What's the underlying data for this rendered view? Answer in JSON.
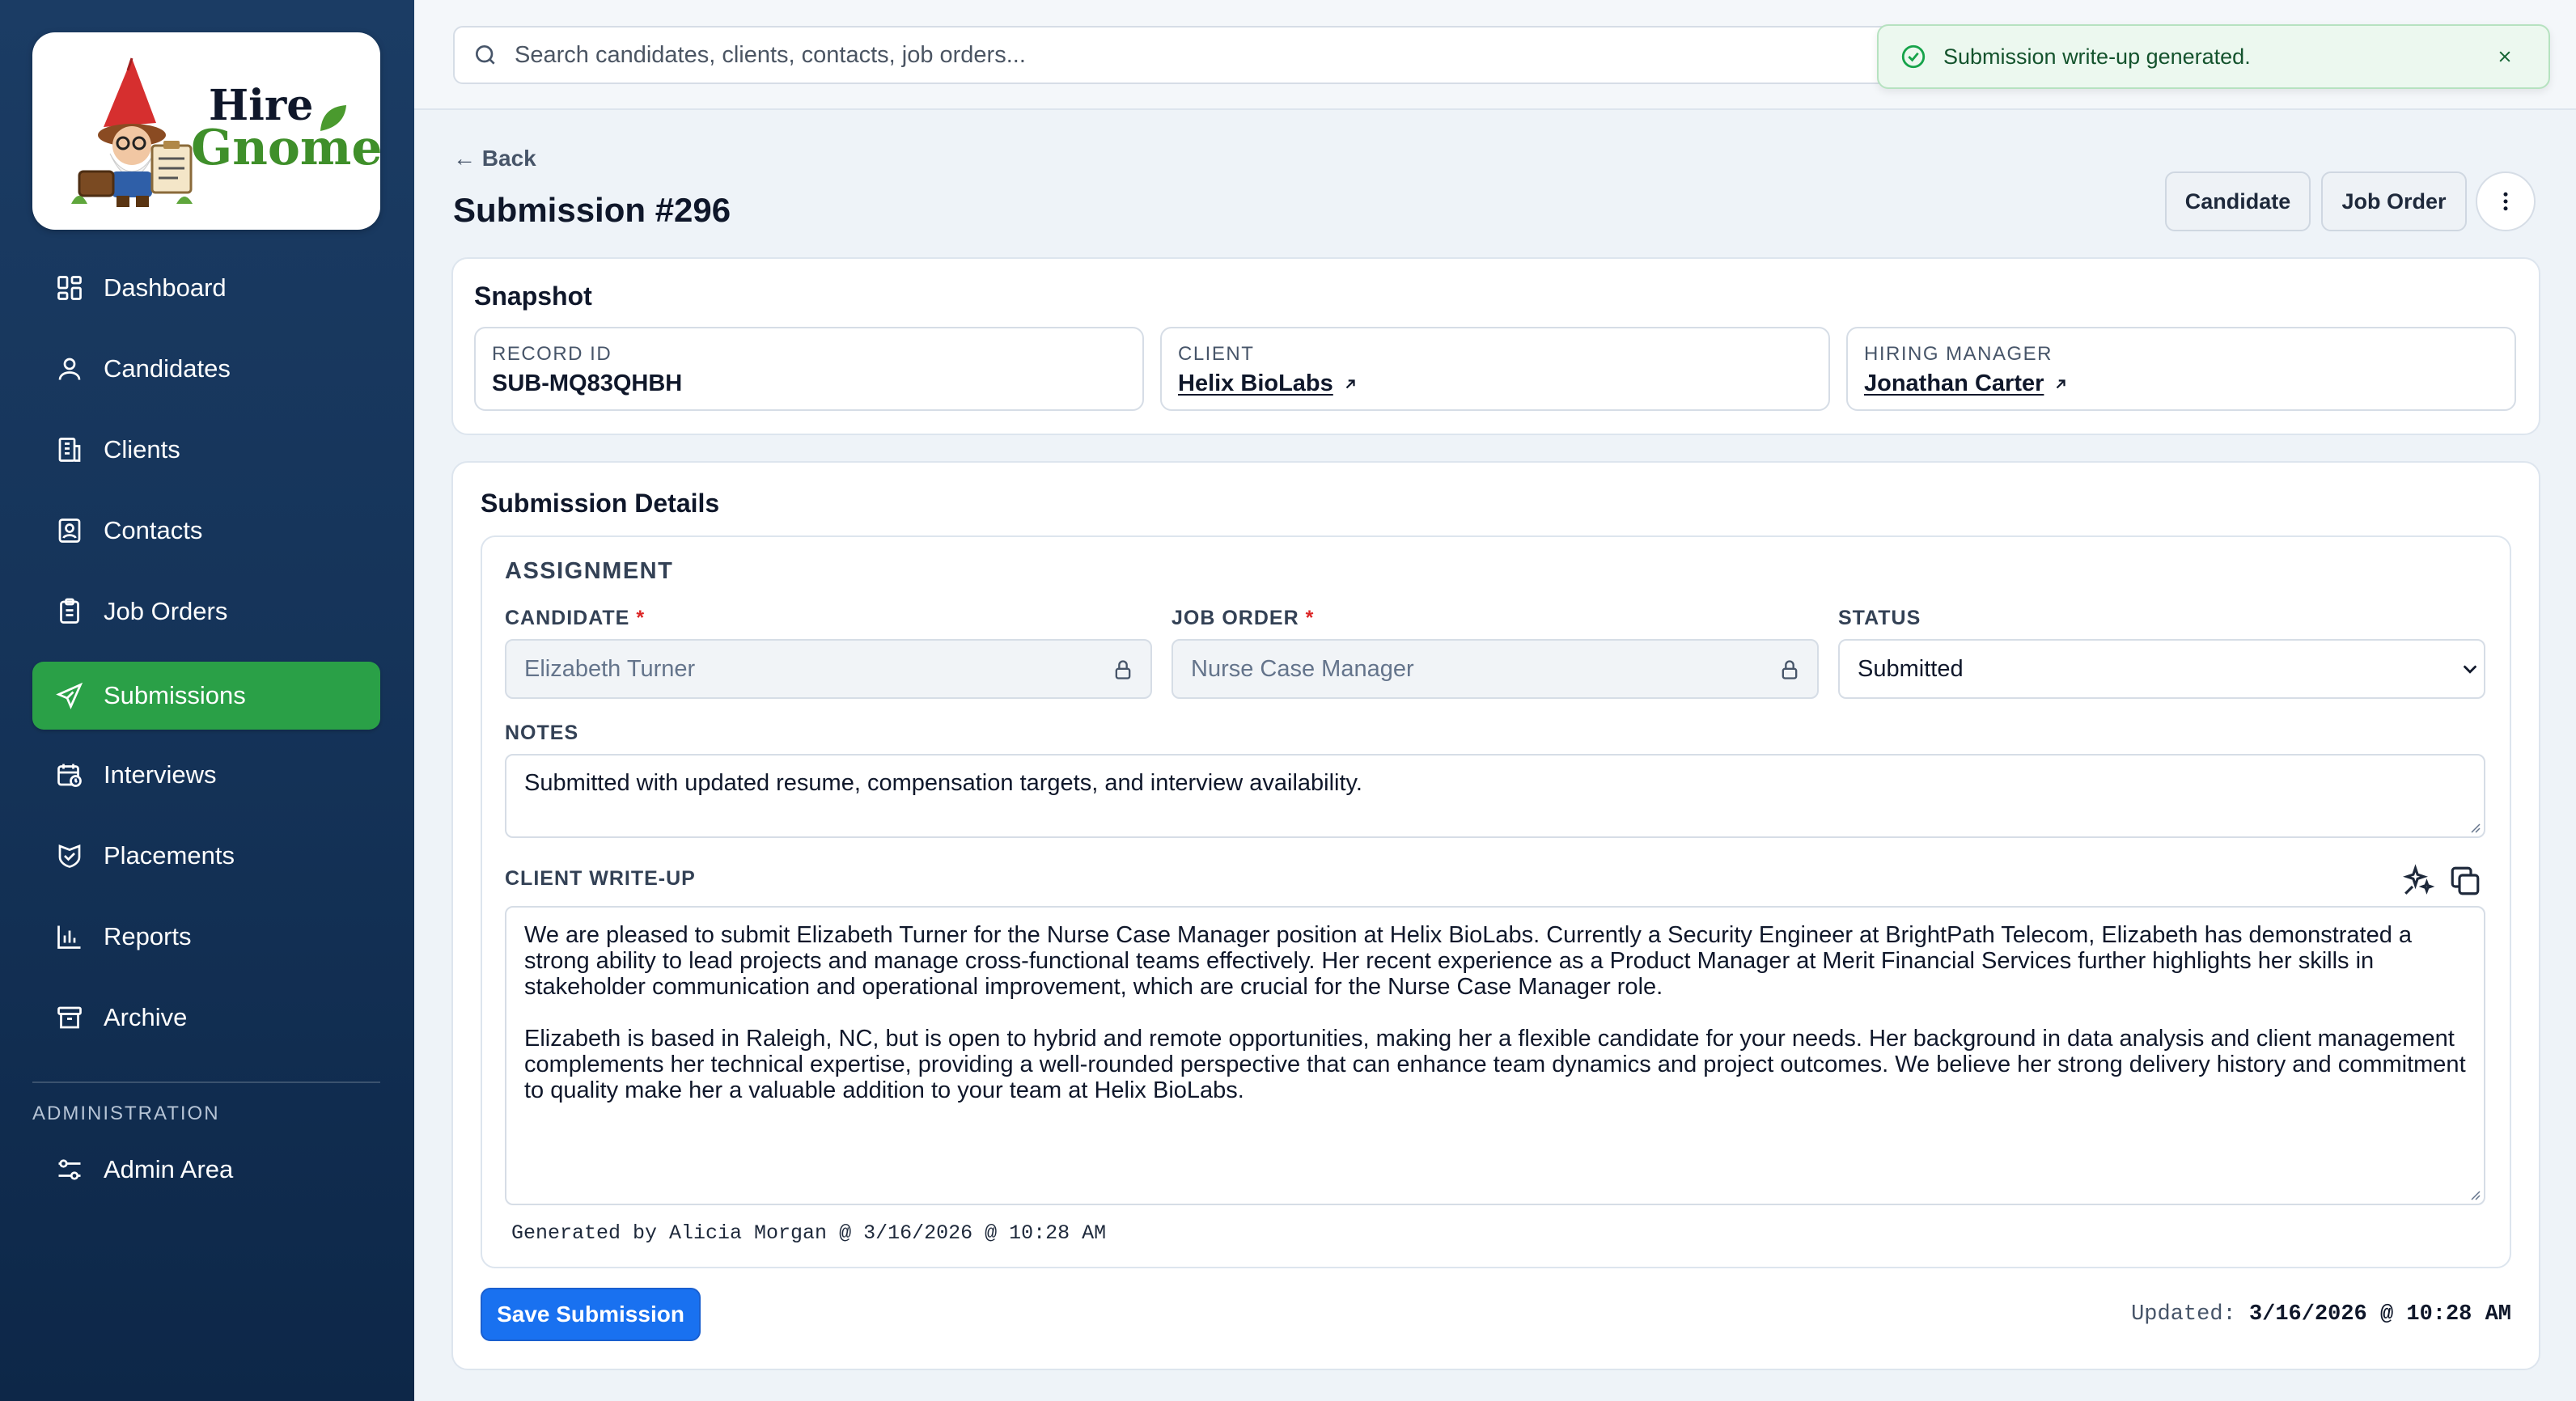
{
  "brand": {
    "line1": "Hire",
    "line2": "Gnome"
  },
  "nav": {
    "items": [
      {
        "label": "Dashboard",
        "icon": "dashboard-icon"
      },
      {
        "label": "Candidates",
        "icon": "user-icon"
      },
      {
        "label": "Clients",
        "icon": "building-icon"
      },
      {
        "label": "Contacts",
        "icon": "contact-card-icon"
      },
      {
        "label": "Job Orders",
        "icon": "clipboard-icon"
      },
      {
        "label": "Submissions",
        "icon": "send-icon",
        "active": true
      },
      {
        "label": "Interviews",
        "icon": "calendar-clock-icon"
      },
      {
        "label": "Placements",
        "icon": "handshake-icon"
      },
      {
        "label": "Reports",
        "icon": "bar-chart-icon"
      },
      {
        "label": "Archive",
        "icon": "archive-icon"
      }
    ],
    "admin_section": "ADMINISTRATION",
    "admin_item": {
      "label": "Admin Area",
      "icon": "sliders-icon"
    }
  },
  "search": {
    "placeholder": "Search candidates, clients, contacts, job orders..."
  },
  "toast": {
    "message": "Submission write-up generated.",
    "type": "success"
  },
  "header": {
    "back_label": "← Back",
    "title": "Submission #296",
    "candidate_button": "Candidate",
    "job_order_button": "Job Order"
  },
  "snapshot": {
    "title": "Snapshot",
    "record_id_label": "RECORD ID",
    "record_id": "SUB-MQ83QHBH",
    "client_label": "CLIENT",
    "client": "Helix BioLabs",
    "hiring_manager_label": "HIRING MANAGER",
    "hiring_manager": "Jonathan Carter"
  },
  "details": {
    "title": "Submission Details",
    "assignment_heading": "ASSIGNMENT",
    "candidate_label": "CANDIDATE",
    "candidate_value": "Elizabeth Turner",
    "job_order_label": "JOB ORDER",
    "job_order_value": "Nurse Case Manager",
    "status_label": "STATUS",
    "status_value": "Submitted",
    "notes_label": "NOTES",
    "notes_value": "Submitted with updated resume, compensation targets, and interview availability.",
    "writeup_label": "CLIENT WRITE-UP",
    "writeup_p1": "We are pleased to submit Elizabeth Turner for the Nurse Case Manager position at Helix BioLabs. Currently a Security Engineer at BrightPath Telecom, Elizabeth has demonstrated a strong ability to lead projects and manage cross-functional teams effectively. Her recent experience as a Product Manager at Merit Financial Services further highlights her skills in stakeholder communication and operational improvement, which are crucial for the Nurse Case Manager role.",
    "writeup_p2": "Elizabeth is based in Raleigh, NC, but is open to hybrid and remote opportunities, making her a flexible candidate for your needs. Her background in data analysis and client management complements her technical expertise, providing a well-rounded perspective that can enhance team dynamics and project outcomes. We believe her strong delivery history and commitment to quality make her a valuable addition to your team at Helix BioLabs.",
    "generated_by": "Generated by Alicia Morgan @ 3/16/2026 @ 10:28 AM"
  },
  "footer": {
    "save_label": "Save Submission",
    "updated_label": "Updated:",
    "updated_value": "3/16/2026 @ 10:28 AM"
  },
  "colors": {
    "sidebar": "#163560",
    "active_nav": "#2aa047",
    "primary_button": "#1971f0",
    "toast_bg": "#ecf8ef",
    "required": "#dc2626"
  }
}
